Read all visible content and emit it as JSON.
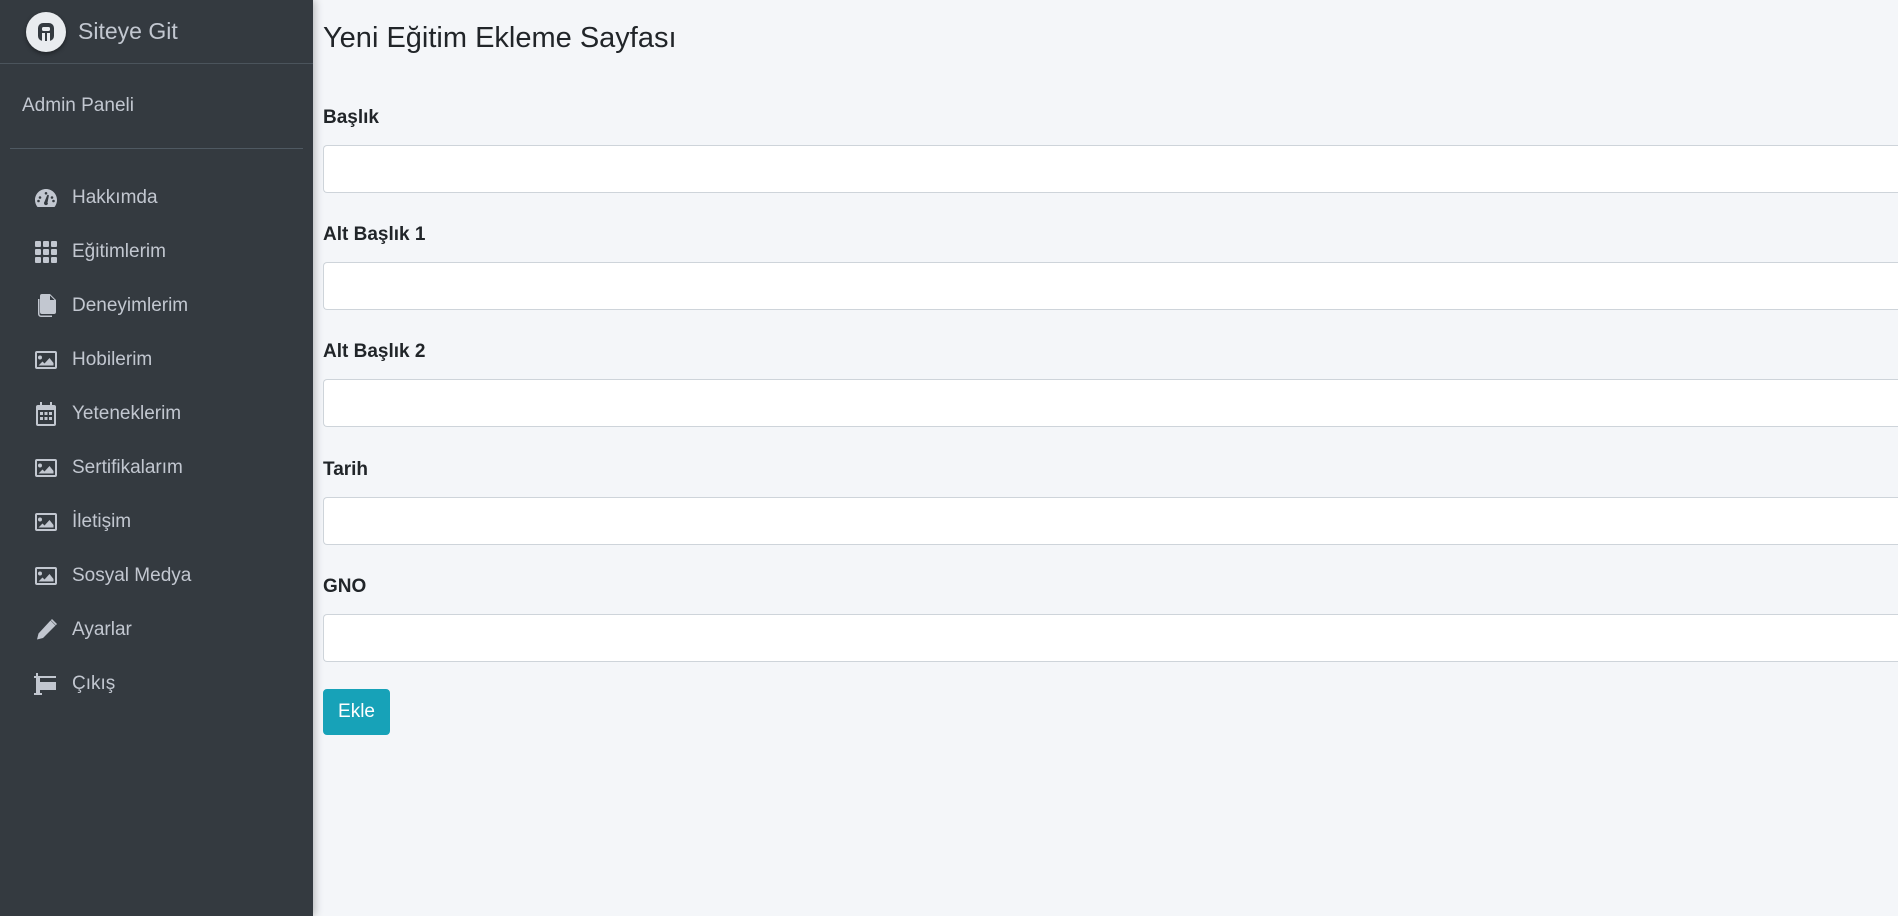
{
  "sidebar": {
    "brand_text": "Siteye Git",
    "panel_title": "Admin Paneli",
    "items": [
      {
        "label": "Hakkımda",
        "icon": "tachometer-icon"
      },
      {
        "label": "Eğitimlerim",
        "icon": "grid-icon"
      },
      {
        "label": "Deneyimlerim",
        "icon": "copy-icon"
      },
      {
        "label": "Hobilerim",
        "icon": "image-icon"
      },
      {
        "label": "Yeteneklerim",
        "icon": "calendar-icon"
      },
      {
        "label": "Sertifikalarım",
        "icon": "image-icon"
      },
      {
        "label": "İletişim",
        "icon": "image-icon"
      },
      {
        "label": "Sosyal Medya",
        "icon": "image-icon"
      },
      {
        "label": "Ayarlar",
        "icon": "pencil-icon"
      },
      {
        "label": "Çıkış",
        "icon": "sign-icon"
      }
    ]
  },
  "main": {
    "page_title": "Yeni Eğitim Ekleme Sayfası",
    "fields": [
      {
        "label": "Başlık",
        "value": ""
      },
      {
        "label": "Alt Başlık 1",
        "value": ""
      },
      {
        "label": "Alt Başlık 2",
        "value": ""
      },
      {
        "label": "Tarih",
        "value": ""
      },
      {
        "label": "GNO",
        "value": ""
      }
    ],
    "submit_label": "Ekle"
  },
  "colors": {
    "sidebar_bg": "#343a40",
    "sidebar_text": "#c2c7d0",
    "content_bg": "#f4f6f9",
    "button_bg": "#17a2b8"
  }
}
